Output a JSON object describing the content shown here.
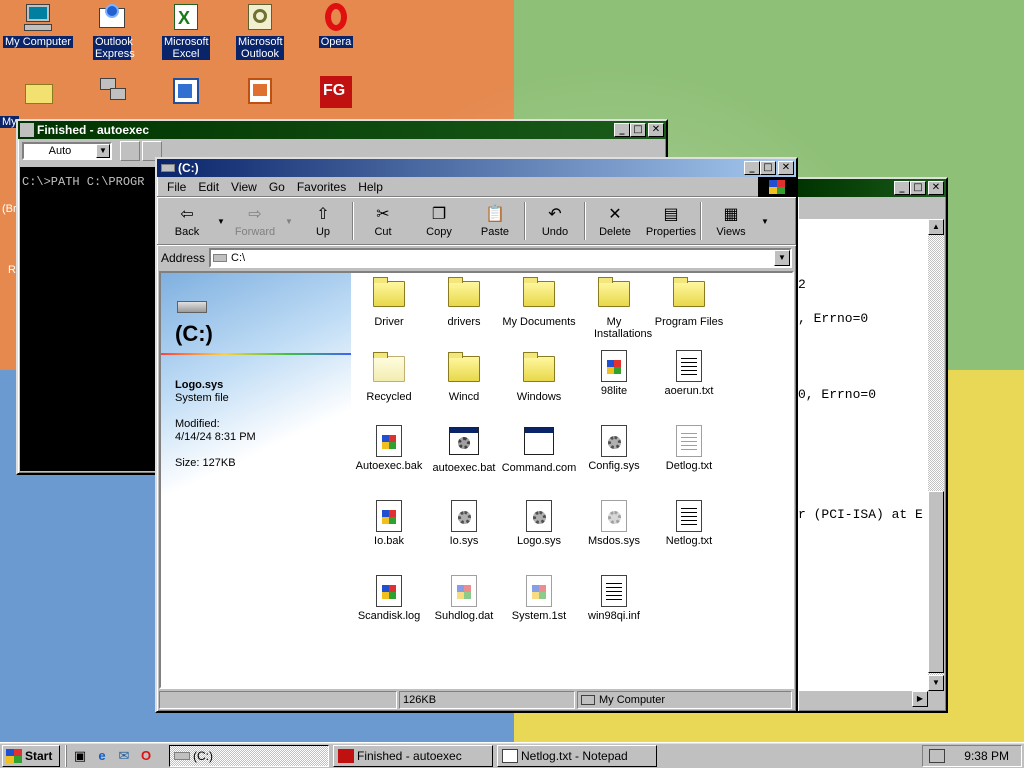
{
  "desktop": {
    "icons": [
      {
        "label": "My Computer",
        "icon": "my-computer-icon"
      },
      {
        "label": "Outlook Express",
        "icon": "outlook-express-icon"
      },
      {
        "label": "Microsoft Excel",
        "icon": "excel-icon"
      },
      {
        "label": "Microsoft Outlook",
        "icon": "outlook-icon"
      },
      {
        "label": "Opera",
        "icon": "opera-icon"
      },
      {
        "label": "My",
        "icon": "my-documents-folder-icon"
      },
      {
        "label": "",
        "icon": "network-neighborhood-icon"
      },
      {
        "label": "",
        "icon": "shortcut-icon"
      },
      {
        "label": "",
        "icon": "powerpoint-icon"
      },
      {
        "label": "FG",
        "icon": "fg-app-icon"
      }
    ],
    "partial_labels": [
      "(Br",
      "R"
    ]
  },
  "dos_window": {
    "title": "Finished - autoexec",
    "font_select": "Auto",
    "screen_text": "C:\\>PATH C:\\PROGR"
  },
  "notepad_window": {
    "title": "Netlog.txt - Notepad",
    "lines": [
      "2",
      ", Errno=0",
      "",
      "0, Errno=0",
      "",
      "",
      "r (PCI-ISA) at E"
    ]
  },
  "explorer": {
    "title": "(C:)",
    "menu": [
      "File",
      "Edit",
      "View",
      "Go",
      "Favorites",
      "Help"
    ],
    "toolbar": [
      {
        "label": "Back",
        "icon": "back-arrow-icon",
        "enabled": true
      },
      {
        "label": "Forward",
        "icon": "forward-arrow-icon",
        "enabled": false
      },
      {
        "label": "Up",
        "icon": "up-folder-icon",
        "enabled": true
      },
      {
        "label": "Cut",
        "icon": "scissors-icon",
        "enabled": true
      },
      {
        "label": "Copy",
        "icon": "copy-icon",
        "enabled": true
      },
      {
        "label": "Paste",
        "icon": "paste-icon",
        "enabled": true
      },
      {
        "label": "Undo",
        "icon": "undo-icon",
        "enabled": true
      },
      {
        "label": "Delete",
        "icon": "delete-x-icon",
        "enabled": true
      },
      {
        "label": "Properties",
        "icon": "properties-icon",
        "enabled": true
      },
      {
        "label": "Views",
        "icon": "views-icon",
        "enabled": true
      }
    ],
    "address_label": "Address",
    "address_value": "C:\\",
    "webview": {
      "drive_title": "(C:)",
      "selected_name": "Logo.sys",
      "selected_type": "System file",
      "modified_label": "Modified:",
      "modified_value": "4/14/24 8:31 PM",
      "size_text": "Size: 127KB"
    },
    "files": [
      {
        "name": "Driver",
        "kind": "folder"
      },
      {
        "name": "drivers",
        "kind": "folder"
      },
      {
        "name": "My Documents",
        "kind": "folder"
      },
      {
        "name": "My Installations",
        "kind": "folder"
      },
      {
        "name": "Program Files",
        "kind": "folder"
      },
      {
        "name": "Recycled",
        "kind": "folder-faded"
      },
      {
        "name": "Wincd",
        "kind": "folder"
      },
      {
        "name": "Windows",
        "kind": "folder"
      },
      {
        "name": "98lite",
        "kind": "flag"
      },
      {
        "name": "aoerun.txt",
        "kind": "text"
      },
      {
        "name": "Autoexec.bak",
        "kind": "flag"
      },
      {
        "name": "autoexec.bat",
        "kind": "batch"
      },
      {
        "name": "Command.com",
        "kind": "app"
      },
      {
        "name": "Config.sys",
        "kind": "gear"
      },
      {
        "name": "Detlog.txt",
        "kind": "text-faint"
      },
      {
        "name": "Io.bak",
        "kind": "flag"
      },
      {
        "name": "Io.sys",
        "kind": "gear"
      },
      {
        "name": "Logo.sys",
        "kind": "gear"
      },
      {
        "name": "Msdos.sys",
        "kind": "gear-faint"
      },
      {
        "name": "Netlog.txt",
        "kind": "text"
      },
      {
        "name": "Scandisk.log",
        "kind": "flag"
      },
      {
        "name": "Suhdlog.dat",
        "kind": "flag-faint"
      },
      {
        "name": "System.1st",
        "kind": "flag-faint"
      },
      {
        "name": "win98qi.inf",
        "kind": "inf"
      }
    ],
    "status": {
      "size": "126KB",
      "zone": "My Computer"
    }
  },
  "taskbar": {
    "start_label": "Start",
    "quicklaunch": [
      "show-desktop-icon",
      "internet-explorer-icon",
      "outlook-express-icon",
      "opera-icon"
    ],
    "tasks": [
      {
        "label": "(C:)",
        "pressed": true
      },
      {
        "label": "Finished - autoexec",
        "pressed": false
      },
      {
        "label": "Netlog.txt - Notepad",
        "pressed": false
      }
    ],
    "clock": "9:38 PM"
  }
}
